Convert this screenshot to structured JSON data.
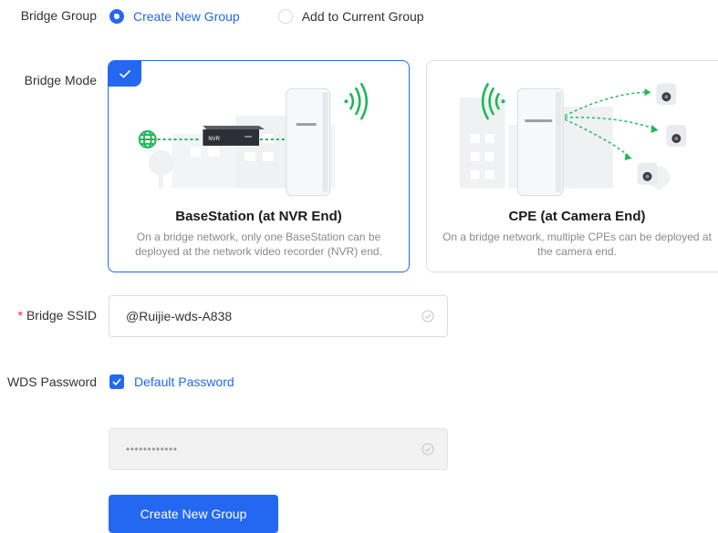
{
  "bridge_group": {
    "label": "Bridge Group",
    "options": [
      {
        "label": "Create New Group",
        "selected": true
      },
      {
        "label": "Add to Current Group",
        "selected": false
      }
    ]
  },
  "bridge_mode": {
    "label": "Bridge Mode",
    "cards": [
      {
        "title": "BaseStation (at NVR End)",
        "description": "On a bridge network, only one BaseStation can be deployed at the network video recorder (NVR) end.",
        "device_text": "NVR",
        "selected": true
      },
      {
        "title": "CPE (at Camera End)",
        "description": "On a bridge network, multiple CPEs can be deployed at the camera end.",
        "selected": false
      }
    ]
  },
  "bridge_ssid": {
    "label": "Bridge SSID",
    "required_mark": "*",
    "value": "@Ruijie-wds-A838"
  },
  "wds_password": {
    "label": "WDS Password",
    "checkbox_label": "Default Password",
    "checked": true,
    "masked_value": "••••••••••••"
  },
  "actions": {
    "create_label": "Create New Group"
  },
  "colors": {
    "accent": "#2468f2",
    "wifi_green": "#1fb85a",
    "required": "#f5222d"
  }
}
